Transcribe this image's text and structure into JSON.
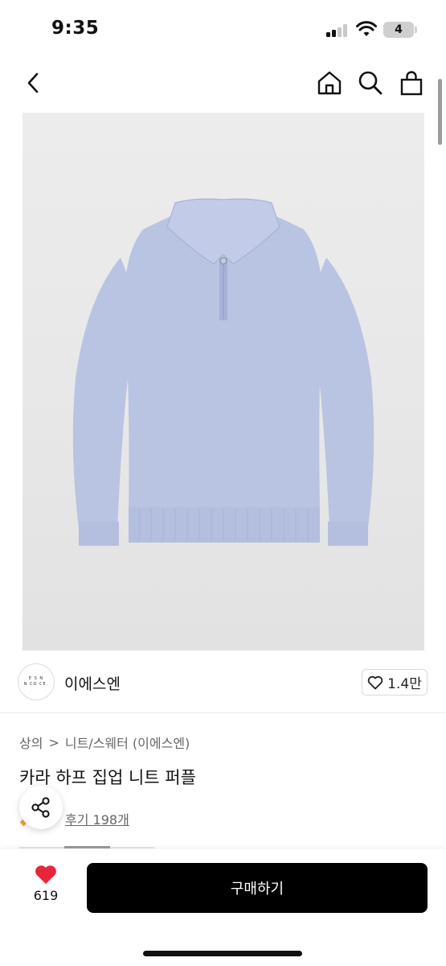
{
  "status_bar": {
    "time": "9:35",
    "battery": "4"
  },
  "brand": {
    "logo_text": [
      "E S N",
      "N CO CE."
    ],
    "name": "이에스엔",
    "likes": "1.4만"
  },
  "breadcrumb": {
    "category": "상의",
    "separator": ">",
    "subcategory": "니트/스웨터 (이에스엔)"
  },
  "product": {
    "title": "카라 하프 집업 니트 퍼플",
    "reviews": "후기 198개"
  },
  "bottom_bar": {
    "wishlist_count": "619",
    "buy_label": "구매하기"
  },
  "colors": {
    "accent_heart": "#e8253a",
    "buy_button": "#000000",
    "sweater": "#b9c3e2",
    "rating_star": "#f2a43a"
  },
  "icons": [
    "back-icon",
    "home-icon",
    "search-icon",
    "shopping-bag-icon",
    "heart-outline-icon",
    "share-icon",
    "heart-filled-icon",
    "star-icon"
  ]
}
